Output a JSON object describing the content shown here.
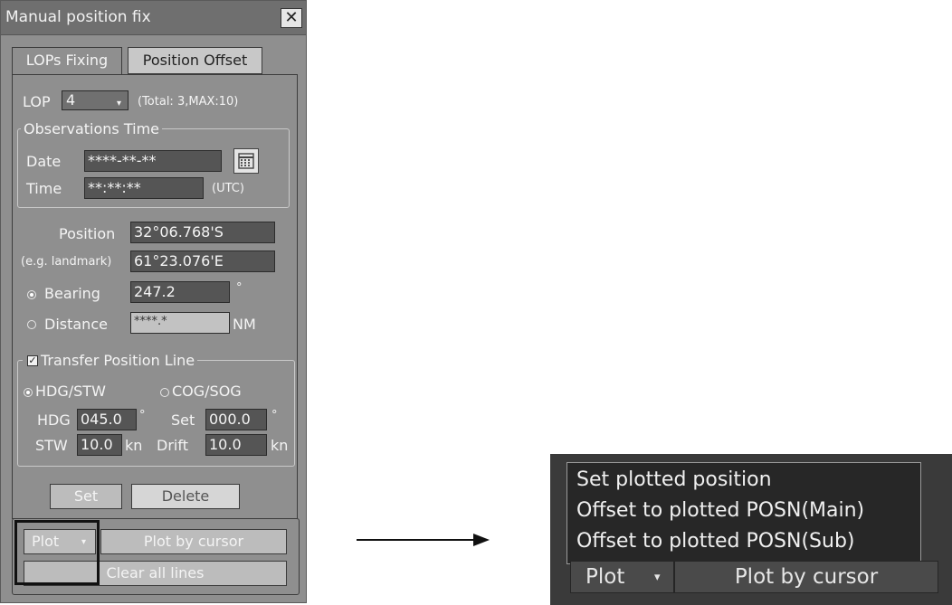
{
  "dialog": {
    "title": "Manual position fix",
    "close_glyph": "✕",
    "tabs": [
      "LOPs Fixing",
      "Position Offset"
    ],
    "lop": {
      "label": "LOP",
      "selected": "4",
      "total_text": "(Total: 3,MAX:10)"
    },
    "observations": {
      "legend": "Observations Time",
      "date_label": "Date",
      "date_value": "****-**-**",
      "time_label": "Time",
      "time_value": "**:**:**",
      "time_unit": "(UTC)"
    },
    "position": {
      "label": "Position",
      "lat": "32°06.768'S",
      "sublabel": "(e.g. landmark)",
      "lon": "61°23.076'E"
    },
    "bearing": {
      "label": "Bearing",
      "value": "247.2",
      "unit": "°",
      "selected": true
    },
    "distance": {
      "label": "Distance",
      "value": "****.*",
      "unit": "NM",
      "selected": false
    },
    "transfer": {
      "legend": "Transfer Position Line",
      "checked": true,
      "check_glyph": "✓",
      "opt1": "HDG/STW",
      "opt2": "COG/SOG",
      "hdg_label": "HDG",
      "hdg_value": "045.0",
      "hdg_unit": "°",
      "set_label": "Set",
      "set_value": "000.0",
      "set_unit": "°",
      "stw_label": "STW",
      "stw_value": "10.0",
      "stw_unit": "kn",
      "drift_label": "Drift",
      "drift_value": "10.0",
      "drift_unit": "kn"
    },
    "buttons": {
      "set": "Set",
      "delete": "Delete",
      "plot": "Plot",
      "plot_by_cursor": "Plot by cursor",
      "clear_all": "Clear all lines"
    }
  },
  "popup": {
    "menu_items": [
      "Set plotted position",
      "Offset to plotted POSN(Main)",
      "Offset to plotted POSN(Sub)"
    ],
    "plot": "Plot",
    "plot_by_cursor": "Plot by cursor"
  },
  "colors": {
    "panel_bg": "#8f8f8f",
    "field_bg": "#555555",
    "popup_bg": "#272727"
  }
}
